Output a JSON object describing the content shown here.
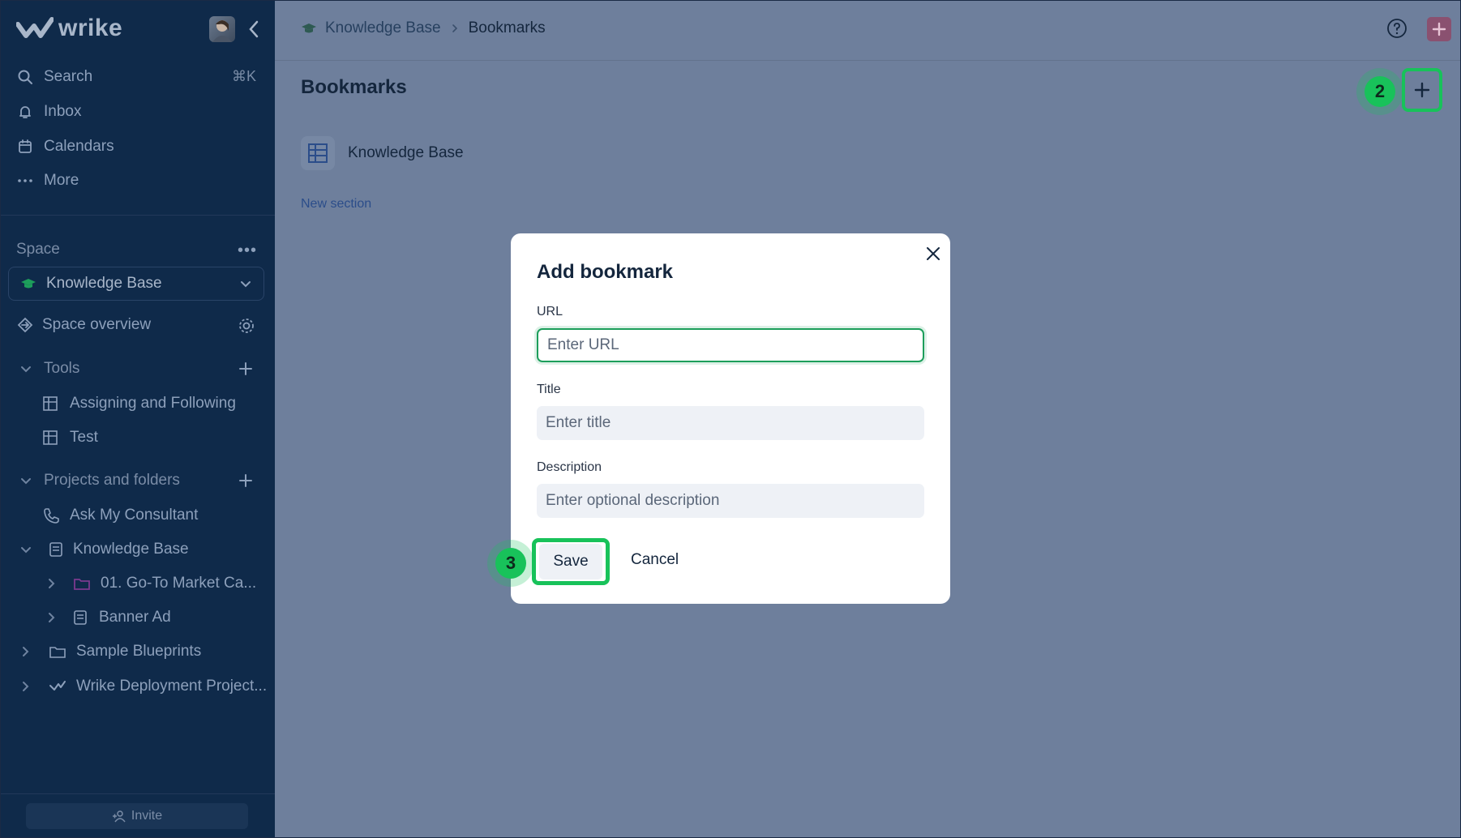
{
  "app": {
    "logo_text": "wrike",
    "brand_color": "#18c25a"
  },
  "sidebar": {
    "nav": [
      {
        "label": "Search",
        "icon": "search-icon",
        "shortcut": "⌘K"
      },
      {
        "label": "Inbox",
        "icon": "bell-icon"
      },
      {
        "label": "Calendars",
        "icon": "calendar-icon"
      },
      {
        "label": "More",
        "icon": "dots-icon"
      }
    ],
    "space_label": "Space",
    "space_selected": "Knowledge Base",
    "space_overview": "Space overview",
    "tools_label": "Tools",
    "tools": [
      "Assigning and Following",
      "Test"
    ],
    "projects_label": "Projects and folders",
    "projects": [
      "Ask My Consultant",
      "Knowledge Base",
      "01. Go-To Market Ca...",
      "Banner Ad",
      "Sample Blueprints",
      "Wrike Deployment Project..."
    ],
    "invite_label": "Invite"
  },
  "header": {
    "breadcrumb": [
      "Knowledge Base",
      "Bookmarks"
    ]
  },
  "main": {
    "title": "Bookmarks",
    "bookmarks": [
      {
        "label": "Knowledge Base"
      }
    ],
    "new_section": "New section"
  },
  "annotations": {
    "step_add": "2",
    "step_save": "3"
  },
  "dialog": {
    "title": "Add bookmark",
    "url_label": "URL",
    "url_placeholder": "Enter URL",
    "title_label": "Title",
    "title_placeholder": "Enter title",
    "description_label": "Description",
    "description_placeholder": "Enter optional description",
    "save_label": "Save",
    "cancel_label": "Cancel"
  }
}
